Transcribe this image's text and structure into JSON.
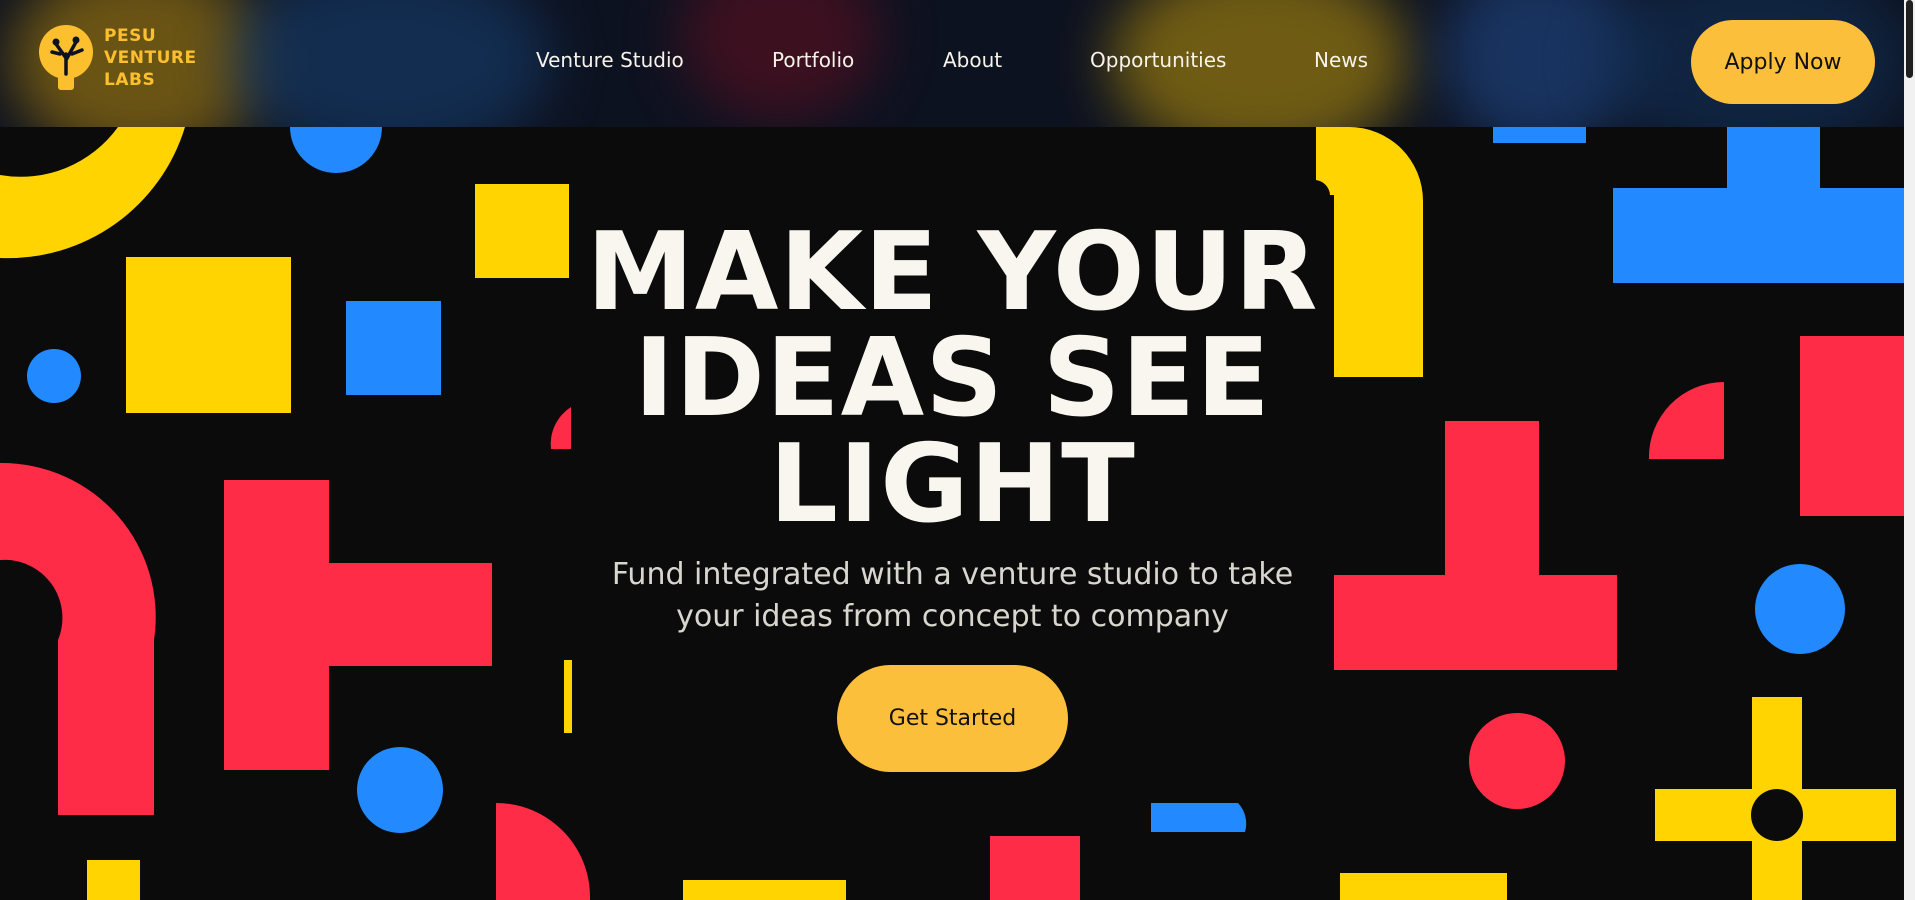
{
  "brand": {
    "logo_lines": [
      "PESU",
      "VENTURE",
      "LABS"
    ],
    "accent": "#fcbf2e"
  },
  "nav": {
    "items": [
      "Venture Studio",
      "Portfolio",
      "About",
      "Opportunities",
      "News"
    ]
  },
  "header": {
    "apply_label": "Apply Now"
  },
  "hero": {
    "headline_lines": [
      "MAKE YOUR",
      "IDEAS SEE",
      "LIGHT"
    ],
    "subtitle_lines": [
      "Fund integrated with a venture studio to take",
      "your ideas from concept to company"
    ],
    "cta_label": "Get Started"
  },
  "colors": {
    "background": "#0b0b0b",
    "yellow": "#ffd400",
    "blue": "#2389ff",
    "red": "#ff2c48",
    "button": "#fcbf3c",
    "text_light": "#f9f6ef"
  }
}
